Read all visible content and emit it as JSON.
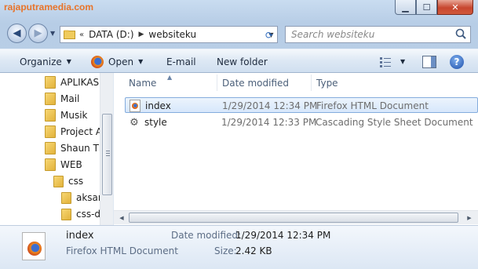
{
  "window": {
    "watermark": "rajaputramedia.com"
  },
  "address": {
    "overflow": "«",
    "drive": "DATA (D:)",
    "folder": "websiteku"
  },
  "search": {
    "placeholder": "Search websiteku"
  },
  "toolbar": {
    "organize": "Organize",
    "open": "Open",
    "email": "E-mail",
    "new_folder": "New folder"
  },
  "nav_tree": [
    {
      "label": "APLIKASI"
    },
    {
      "label": "Mail"
    },
    {
      "label": "Musik"
    },
    {
      "label": "Project A"
    },
    {
      "label": "Shaun Th"
    },
    {
      "label": "WEB"
    },
    {
      "label": "css"
    },
    {
      "label": "aksan"
    },
    {
      "label": "css-d"
    }
  ],
  "columns": {
    "name": "Name",
    "date_modified": "Date modified",
    "type": "Type"
  },
  "files": [
    {
      "name": "index",
      "date": "1/29/2014 12:34 PM",
      "type": "Firefox HTML Document",
      "icon": "firefox-file-icon",
      "selected": true
    },
    {
      "name": "style",
      "date": "1/29/2014 12:33 PM",
      "type": "Cascading Style Sheet Document",
      "icon": "css-file-icon",
      "selected": false
    }
  ],
  "details": {
    "name": "index",
    "type": "Firefox HTML Document",
    "date_label": "Date modified:",
    "date_value": "1/29/2014 12:34 PM",
    "size_label": "Size:",
    "size_value": "2.42 KB"
  }
}
